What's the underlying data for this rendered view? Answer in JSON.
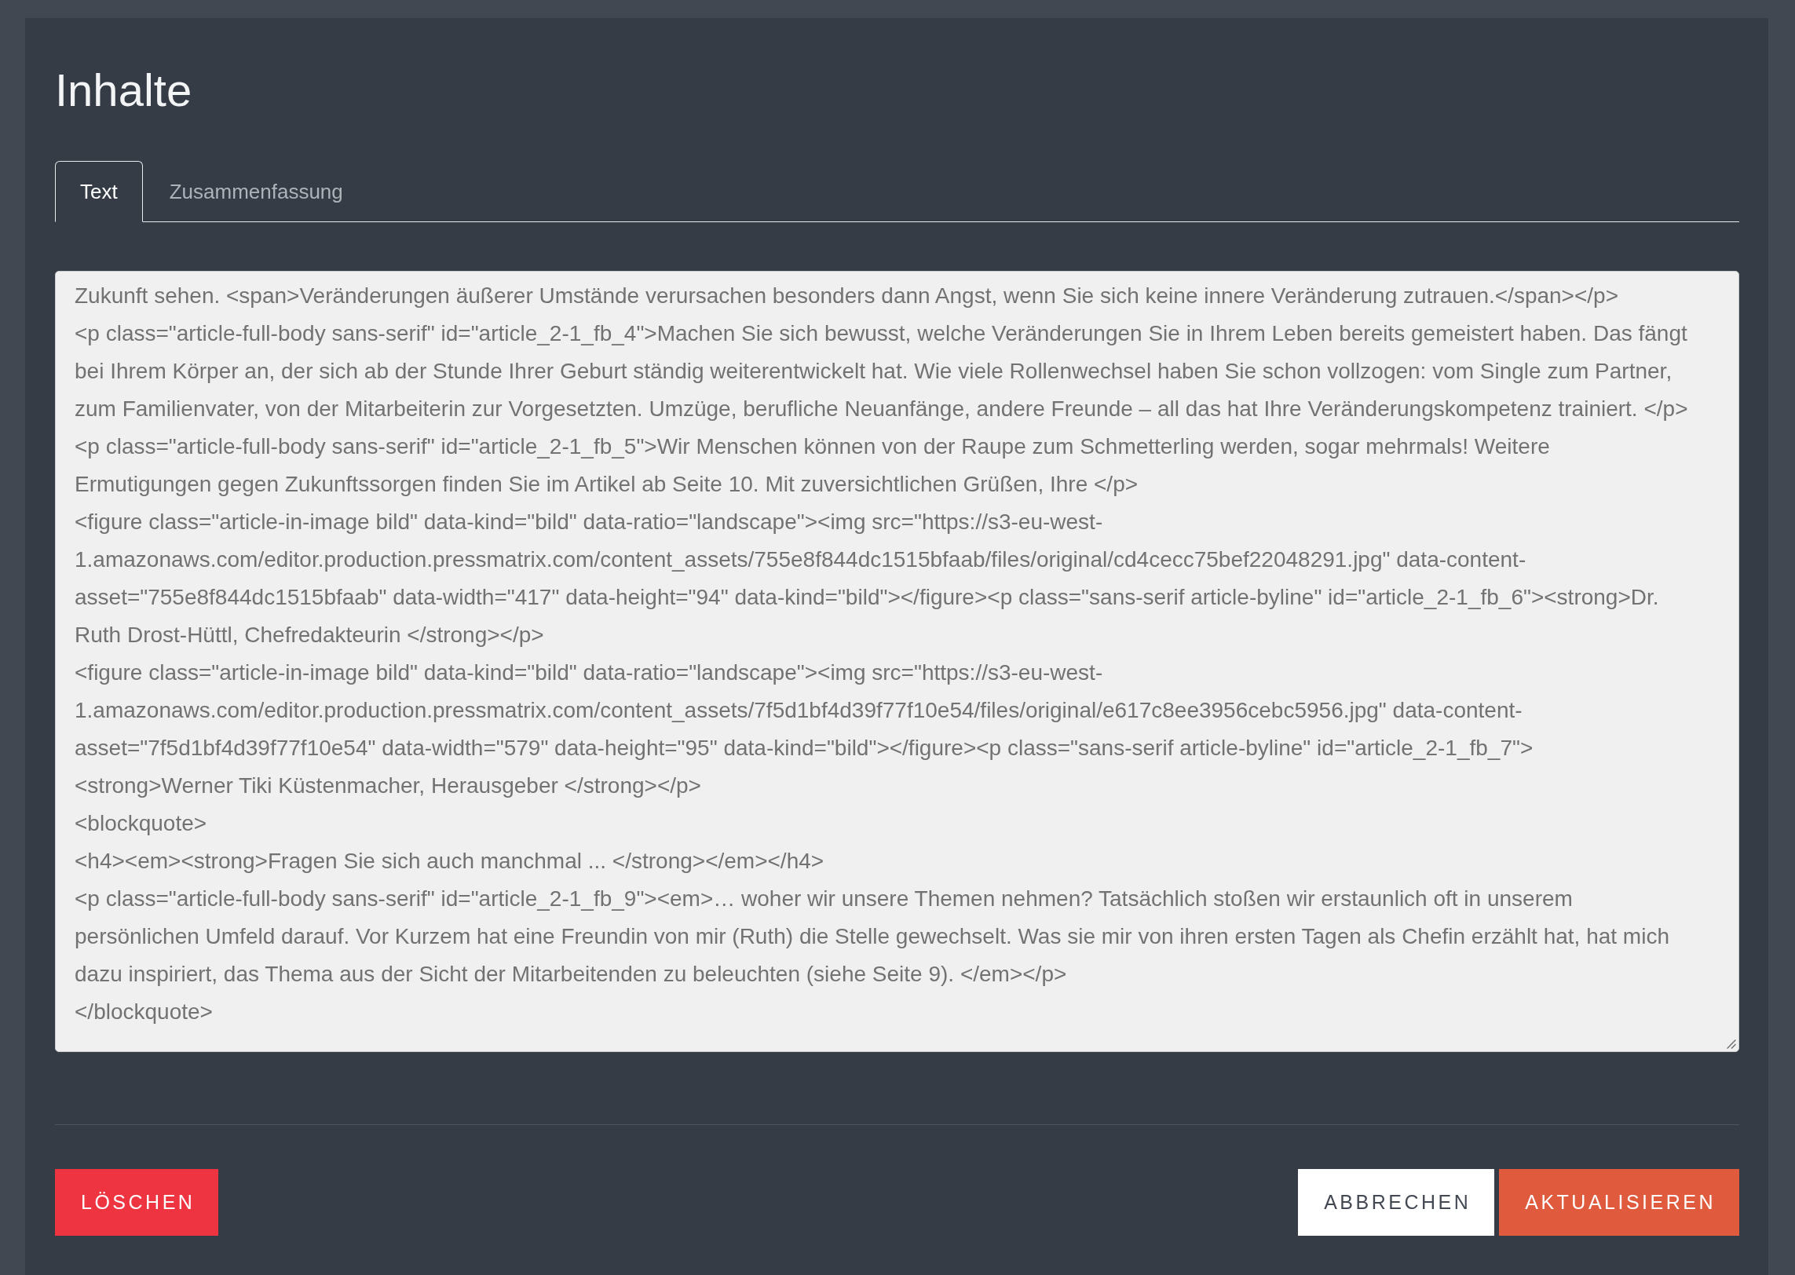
{
  "dialog": {
    "title": "Inhalte"
  },
  "tabs": [
    {
      "label": "Text",
      "selected": true
    },
    {
      "label": "Zusammenfassung",
      "selected": false
    }
  ],
  "text_area": {
    "lines": [
      "Zukunft sehen. <span>Veränderungen äußerer Umstände verursachen besonders dann Angst, wenn Sie sich keine innere Veränderung zutrauen.</span></p>",
      "<p class=\"article-full-body sans-serif\" id=\"article_2-1_fb_4\">Machen Sie sich bewusst, welche Veränderungen Sie in Ihrem Leben bereits gemeistert haben. Das fängt",
      "bei Ihrem Körper an, der sich ab der Stunde Ihrer Geburt ständig weiterentwickelt hat. Wie viele Rollenwechsel haben Sie schon vollzogen: vom Single zum Partner,",
      "zum Familienvater, von der Mitarbeiterin zur Vorgesetzten. Umzüge, berufliche Neuanfänge, andere Freunde – all das hat Ihre Veränderungskompetenz trainiert. </p>",
      "<p class=\"article-full-body sans-serif\" id=\"article_2-1_fb_5\">Wir Menschen können von der Raupe zum Schmetterling werden, sogar mehrmals! Weitere",
      "Ermutigungen gegen Zukunftssorgen finden Sie im Artikel ab Seite 10. Mit zuversichtlichen Grüßen, Ihre </p>",
      "<figure class=\"article-in-image bild\" data-kind=\"bild\" data-ratio=\"landscape\"><img src=\"https://s3-eu-west-",
      "1.amazonaws.com/editor.production.pressmatrix.com/content_assets/755e8f844dc1515bfaab/files/original/cd4cecc75bef22048291.jpg\" data-content-",
      "asset=\"755e8f844dc1515bfaab\" data-width=\"417\" data-height=\"94\" data-kind=\"bild\"></figure><p class=\"sans-serif article-byline\" id=\"article_2-1_fb_6\"><strong>Dr.",
      "Ruth Drost-Hüttl, Chefredakteurin </strong></p>",
      "<figure class=\"article-in-image bild\" data-kind=\"bild\" data-ratio=\"landscape\"><img src=\"https://s3-eu-west-",
      "1.amazonaws.com/editor.production.pressmatrix.com/content_assets/7f5d1bf4d39f77f10e54/files/original/e617c8ee3956cebc5956.jpg\" data-content-",
      "asset=\"7f5d1bf4d39f77f10e54\" data-width=\"579\" data-height=\"95\" data-kind=\"bild\"></figure><p class=\"sans-serif article-byline\" id=\"article_2-1_fb_7\">",
      "<strong>Werner Tiki Küstenmacher, Herausgeber </strong></p>",
      "<blockquote>",
      "<h4><em><strong>Fragen Sie sich auch manchmal ... </strong></em></h4>",
      "<p class=\"article-full-body sans-serif\" id=\"article_2-1_fb_9\"><em>… woher wir unsere Themen nehmen? Tatsächlich stoßen wir erstaunlich oft in unserem",
      "persönlichen Umfeld darauf. Vor Kurzem hat eine Freundin von mir (Ruth) die Stelle gewechselt. Was sie mir von ihren ersten Tagen als Chefin erzählt hat, hat mich",
      "dazu inspiriert, das Thema aus der Sicht der Mitarbeitenden zu beleuchten (siehe Seite 9). </em></p>",
      "</blockquote>"
    ]
  },
  "actions": {
    "left": [
      {
        "label": "LÖSCHEN",
        "kind": "danger"
      }
    ],
    "right": [
      {
        "label": "ABBRECHEN",
        "kind": "cancel"
      },
      {
        "label": "AKTUALISIEREN",
        "kind": "primary"
      }
    ]
  }
}
